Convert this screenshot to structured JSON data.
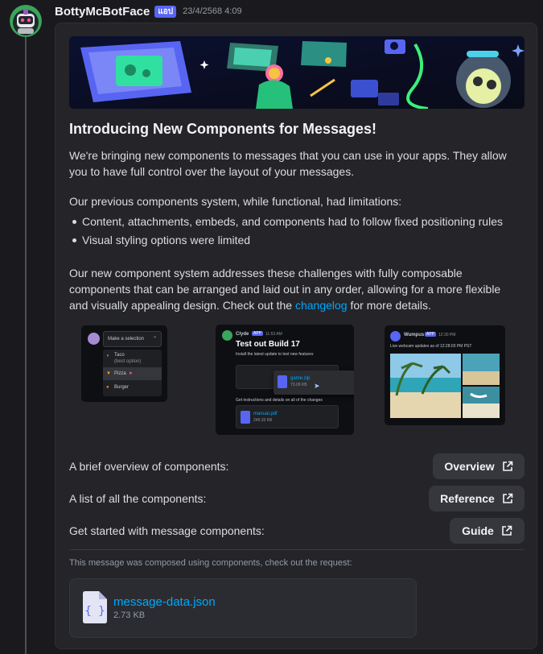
{
  "message": {
    "author": "BottyMcBotFace",
    "badge": "แอป",
    "timestamp": "23/4/2568 4:09"
  },
  "content": {
    "title": "Introducing New Components for Messages!",
    "intro": "We're bringing new components to messages that you can use in your apps. They allow you to have full control over the layout of your messages.",
    "previous": "Our previous components system, while functional, had limitations:",
    "bullets": [
      "Content, attachments, embeds, and components had to follow fixed positioning rules",
      "Visual styling options were limited"
    ],
    "new_system_before": "Our new component system addresses these challenges with fully composable components that can be arranged and laid out in any order, allowing for a more flexible and visually appealing design. Check out the ",
    "changelog_link": "changelog",
    "new_system_after": " for more details."
  },
  "gallery": {
    "shot1": {
      "placeholder": "Make a selection",
      "options": [
        {
          "label": "Taco",
          "sub": "(best option)"
        },
        {
          "label": "Pizza",
          "sub": ""
        },
        {
          "label": "Burger",
          "sub": ""
        }
      ]
    },
    "shot2": {
      "author": "Clyde",
      "badge": "APP",
      "time": "11:53 AM",
      "title": "Test out Build 17",
      "subtitle": "Install the latest update to test new features",
      "file1": "game.zip",
      "file1_size": "73.09 KB",
      "instructions": "Get instructions and details on all of the changes",
      "file2": "manual.pdf",
      "file2_size": "249.33 KB"
    },
    "shot3": {
      "author": "Wumpus",
      "badge": "APP",
      "time": "12:30 PM",
      "text": "Live webcam updates as of 12:28:03 PM PST"
    }
  },
  "links": [
    {
      "label": "A brief overview of components:",
      "button": "Overview"
    },
    {
      "label": "A list of all the components:",
      "button": "Reference"
    },
    {
      "label": "Get started with message components:",
      "button": "Guide"
    }
  ],
  "footer": {
    "note": "This message was composed using components, check out the request:",
    "file_name": "message-data.json",
    "file_size": "2.73 KB"
  },
  "colors": {
    "background": "#1a1a1e",
    "card": "#242429",
    "accent_badge": "#5865f2",
    "link": "#00a8fc",
    "button": "#36373d"
  },
  "icons": [
    "bot-avatar",
    "external-link-icon",
    "json-file-icon"
  ]
}
